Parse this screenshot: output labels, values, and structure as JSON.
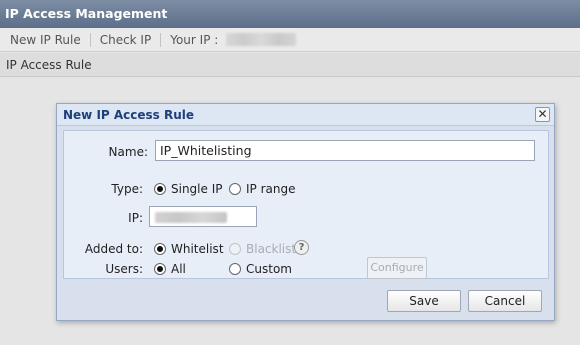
{
  "window": {
    "title": "IP Access Management"
  },
  "toolbar": {
    "new_ip_rule": "New IP Rule",
    "check_ip": "Check IP",
    "your_ip_label": "Your IP :"
  },
  "subbar": {
    "title": "IP Access Rule"
  },
  "dialog": {
    "title": "New IP Access Rule",
    "close_glyph": "✕",
    "name_label": "Name:",
    "name_value": "IP_Whitelisting",
    "type_label": "Type:",
    "type_options": [
      "Single IP",
      "IP range"
    ],
    "type_selected": "Single IP",
    "ip_label": "IP:",
    "added_to_label": "Added to:",
    "added_to_options": [
      "Whitelist",
      "Blacklist"
    ],
    "added_to_selected": "Whitelist",
    "help_glyph": "?",
    "users_label": "Users:",
    "users_options": [
      "All",
      "Custom"
    ],
    "users_selected": "All",
    "configure_label": "Configure",
    "save_label": "Save",
    "cancel_label": "Cancel"
  }
}
